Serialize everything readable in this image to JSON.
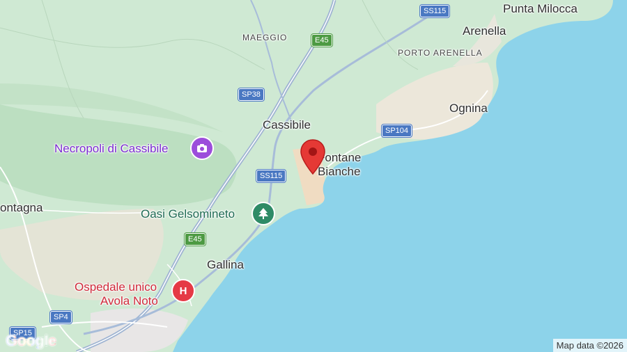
{
  "map": {
    "places": {
      "punta_milocca": "Punta Milocca",
      "arenella": "Arenella",
      "porto_arenella": "PORTO ARENELLA",
      "maeggio": "MAEGGIO",
      "ognina": "Ognina",
      "cassibile": "Cassibile",
      "fontane_bianche_1": "Fontane",
      "fontane_bianche_2": "Bianche",
      "montagna": "ontagna",
      "gallina": "Gallina"
    },
    "pois": {
      "necropoli": "Necropoli di Cassibile",
      "oasi": "Oasi Gelsomineto",
      "ospedale_1": "Ospedale unico",
      "ospedale_2": "Avola Noto"
    },
    "roads": {
      "ss115_top": "SS115",
      "e45_top": "E45",
      "sp38": "SP38",
      "sp104": "SP104",
      "ss115_mid": "SS115",
      "e45_bottom": "E45",
      "sp4": "SP4",
      "sp15": "SP15"
    },
    "logo": "Google",
    "attribution": "Map data ©2026"
  },
  "colors": {
    "sea": "#8dd3ea",
    "land": "#cfe9d3",
    "pin": "#e53935",
    "highway": "#8ea8c9",
    "poi_purple": "#9c4ddb",
    "poi_green": "#2e8b66",
    "poi_red": "#e53945"
  },
  "icons": {
    "necropoli": "camera-icon",
    "oasi": "tree-icon",
    "ospedale": "hospital-icon",
    "marker": "location-pin-icon"
  }
}
